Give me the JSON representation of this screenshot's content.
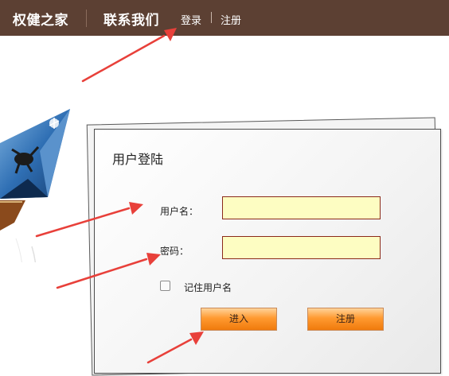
{
  "header": {
    "brand": "权健之家",
    "contact": "联系我们",
    "login_link": "登录",
    "register_link": "注册",
    "background_color": "#5c4033"
  },
  "login_panel": {
    "title": "用户登陆",
    "username_label": "用户名：",
    "username_value": "",
    "password_label": "密码：",
    "password_value": "",
    "remember_label": "记住用户名",
    "remember_checked": false,
    "enter_button": "进入",
    "register_button": "注册"
  },
  "colors": {
    "input_background": "#fdfdc2",
    "input_border": "#8b2a1a",
    "button_orange": "#ff9a30",
    "arrow_red": "#e8403a"
  }
}
